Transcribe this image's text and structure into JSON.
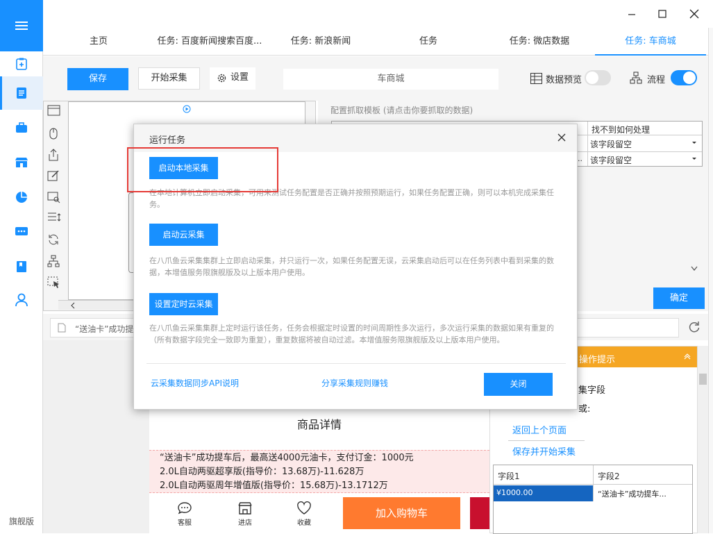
{
  "sidebar": {
    "edition": "旗舰版",
    "items": [
      {
        "icon": "clipboard-plus-icon"
      },
      {
        "icon": "document-icon"
      },
      {
        "icon": "briefcase-icon"
      },
      {
        "icon": "store-icon"
      },
      {
        "icon": "pie-chart-icon"
      },
      {
        "icon": "chat-icon"
      },
      {
        "icon": "book-icon"
      },
      {
        "icon": "user-icon"
      }
    ]
  },
  "tabs": [
    {
      "label": "主页"
    },
    {
      "label": "任务: 百度新闻搜索百度..."
    },
    {
      "label": "任务: 新浪新闻"
    },
    {
      "label": "任务"
    },
    {
      "label": "任务: 微店数据"
    },
    {
      "label": "任务: 车商城"
    }
  ],
  "toolbar": {
    "save": "保存",
    "start": "开始采集",
    "settings": "设置",
    "task_name": "车商城",
    "data_preview": "数据预览",
    "flow": "流程",
    "data_preview_on": false,
    "flow_on": true
  },
  "right_panel": {
    "title": "配置抓取模板 (请点击你要抓取的数据)",
    "column_header": "找不到如何处理",
    "rows": [
      {
        "left": "",
        "value": "该字段留空"
      },
      {
        "left": "..",
        "value": "该字段留空"
      }
    ],
    "confirm": "确定"
  },
  "url_bar": {
    "text": "“送油卡”成功提"
  },
  "browser": {
    "product_title": "商品详情",
    "info_lines": [
      "“送油卡”成功提车后，最高送4000元油卡，支付订金：1000元",
      "2.0L自动两驱超享版(指导价：13.68万)-11.628万",
      "2.0L自动两驱周年增值版(指导价：15.68万)-13.1712万"
    ],
    "bottom_nav": [
      {
        "label": "客服",
        "icon": "chat-bubble-icon"
      },
      {
        "label": "进店",
        "icon": "shop-icon"
      },
      {
        "label": "收藏",
        "icon": "heart-icon"
      }
    ],
    "add_cart": "加入购物车"
  },
  "hint_panel": {
    "title": "操作提示",
    "lines": [
      "集字段",
      "或:"
    ],
    "links": [
      "返回上个页面",
      "保存并开始采集"
    ],
    "table": {
      "headers": [
        "字段1",
        "字段2"
      ],
      "row": [
        "¥1000.00",
        "“送油卡”成功提车..."
      ]
    }
  },
  "modal": {
    "title": "运行任务",
    "sections": [
      {
        "button": "启动本地采集",
        "desc": "在本地计算机立即启动采集，可用来测试任务配置是否正确并按照预期运行，如果任务配置正确，则可以本机完成采集任务。"
      },
      {
        "button": "启动云采集",
        "desc": "在八爪鱼云采集集群上立即启动采集，并只运行一次，如果任务配置无误，云采集启动后可以在任务列表中看到采集的数据，本增值服务限旗舰版及以上版本用户使用。"
      },
      {
        "button": "设置定时云采集",
        "desc": "在八爪鱼云采集集群上定时运行该任务，任务会根据定时设置的时间周期性多次运行，多次运行采集的数据如果有重复的（所有数据字段完全一致即为重复），重复数据将被自动过滤。本增值服务限旗舰版及以上版本用户使用。"
      }
    ],
    "footer_links": [
      "云采集数据同步API说明",
      "分享采集规则赚钱"
    ],
    "close": "关闭"
  },
  "colors": {
    "accent": "#1890ff",
    "highlight": "#e53935",
    "orange": "#ff7a2f",
    "hint_header": "#f5a623"
  }
}
